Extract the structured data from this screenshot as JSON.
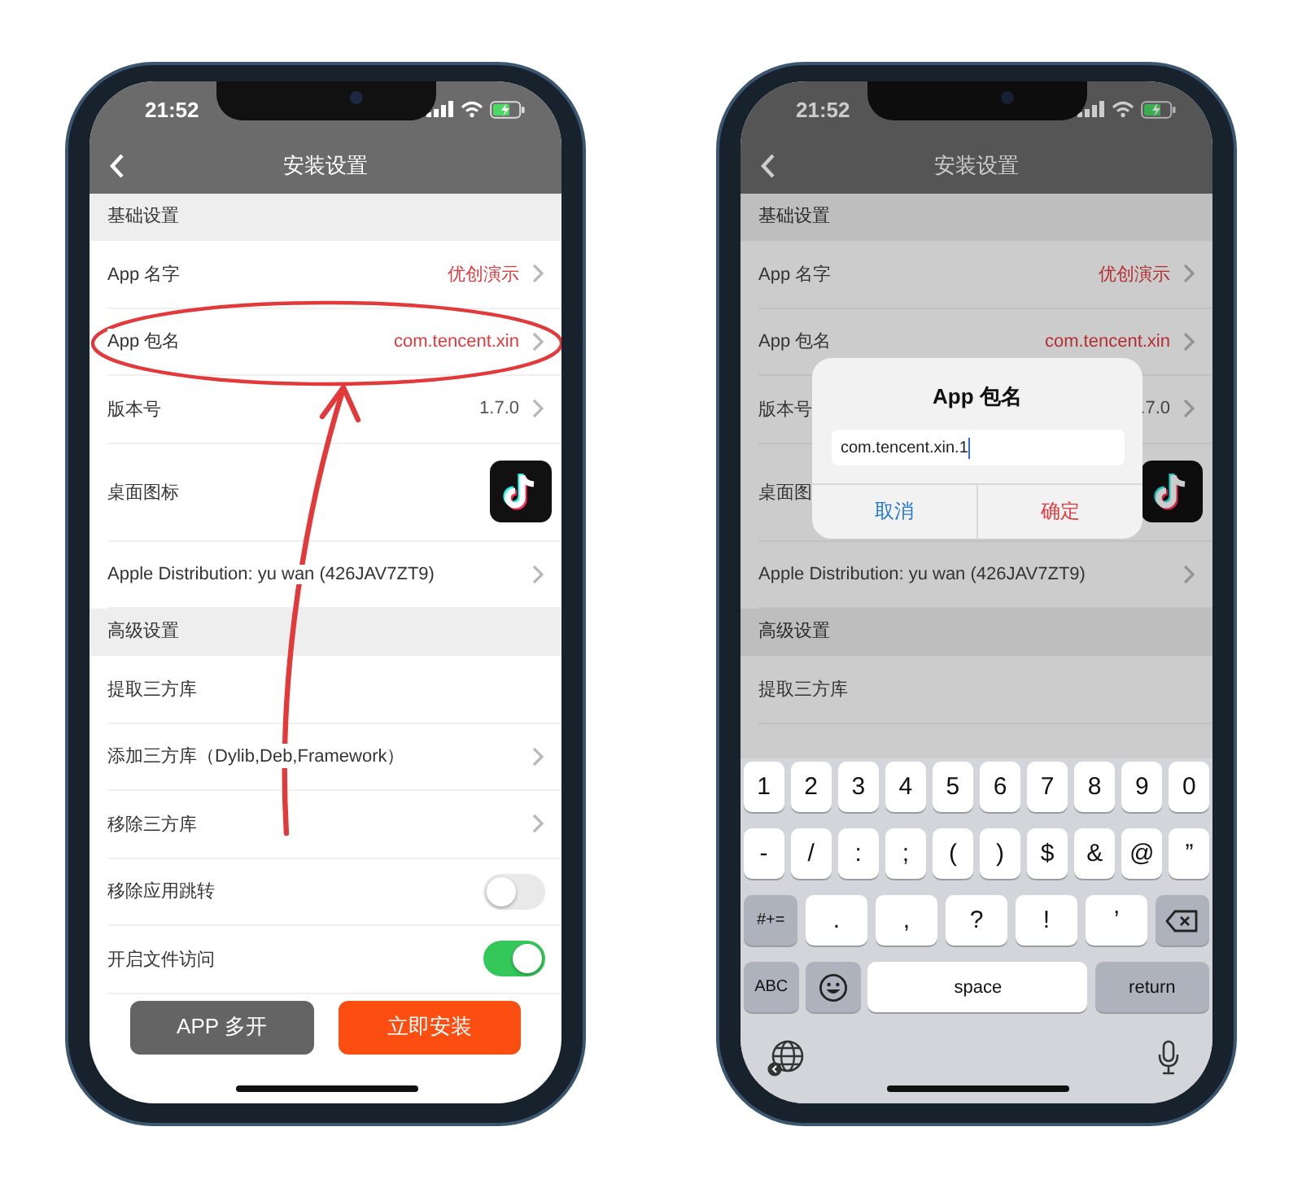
{
  "phones": [
    {
      "status_bar": {
        "time": "21:52"
      },
      "nav": {
        "title": "安装设置"
      },
      "annotated": true,
      "sections": [
        {
          "header": "基础设置",
          "rows": [
            {
              "kind": "value",
              "label": "App 名字",
              "value": "优创演示",
              "accent": true,
              "chevron": true
            },
            {
              "kind": "value",
              "label": "App 包名",
              "value": "com.tencent.xin",
              "accent": true,
              "chevron": true
            },
            {
              "kind": "value",
              "label": "版本号",
              "value": "1.7.0",
              "accent": false,
              "chevron": true
            },
            {
              "kind": "icon",
              "label": "桌面图标"
            },
            {
              "kind": "value",
              "label": "Apple Distribution: yu wan (426JAV7ZT9)",
              "chevron": true
            }
          ]
        },
        {
          "header": "高级设置",
          "rows": [
            {
              "kind": "value",
              "label": "提取三方库"
            },
            {
              "kind": "value",
              "label": "添加三方库（Dylib,Deb,Framework）",
              "chevron": true
            },
            {
              "kind": "value",
              "label": "移除三方库",
              "chevron": true
            },
            {
              "kind": "toggle",
              "label": "移除应用跳转",
              "on": false
            },
            {
              "kind": "toggle",
              "label": "开启文件访问",
              "on": true
            }
          ]
        }
      ],
      "buttons": [
        {
          "label": "APP 多开",
          "kind": "secondary"
        },
        {
          "label": "立即安装",
          "kind": "primary"
        }
      ]
    },
    {
      "status_bar": {
        "time": "21:52"
      },
      "nav": {
        "title": "安装设置"
      },
      "dimmed": true,
      "sections": [
        {
          "header": "基础设置",
          "rows": [
            {
              "kind": "value",
              "label": "App 名字",
              "value": "优创演示",
              "accent": true,
              "chevron": true
            },
            {
              "kind": "value",
              "label": "App 包名",
              "value": "com.tencent.xin",
              "accent": true,
              "chevron": true
            },
            {
              "kind": "value",
              "label": "版本号",
              "value": ".7.0",
              "accent": false,
              "chevron": true
            },
            {
              "kind": "icon",
              "label": "桌面图"
            },
            {
              "kind": "value",
              "label": "Apple Distribution: yu wan (426JAV7ZT9)",
              "chevron": true
            }
          ]
        },
        {
          "header": "高级设置",
          "rows": [
            {
              "kind": "value",
              "label": "提取三方库"
            }
          ]
        }
      ],
      "dialog": {
        "title": "App 包名",
        "value": "com.tencent.xin.1",
        "buttons": [
          {
            "label": "取消",
            "kind": "cancel"
          },
          {
            "label": "确定",
            "kind": "confirm"
          }
        ]
      },
      "keyboard": {
        "rows": [
          {
            "keys": [
              {
                "kind": "char",
                "label": "1"
              },
              {
                "kind": "char",
                "label": "2"
              },
              {
                "kind": "char",
                "label": "3"
              },
              {
                "kind": "char",
                "label": "4"
              },
              {
                "kind": "char",
                "label": "5"
              },
              {
                "kind": "char",
                "label": "6"
              },
              {
                "kind": "char",
                "label": "7"
              },
              {
                "kind": "char",
                "label": "8"
              },
              {
                "kind": "char",
                "label": "9"
              },
              {
                "kind": "char",
                "label": "0"
              }
            ]
          },
          {
            "keys": [
              {
                "kind": "char",
                "label": "-"
              },
              {
                "kind": "char",
                "label": "/"
              },
              {
                "kind": "char",
                "label": ":"
              },
              {
                "kind": "char",
                "label": ";"
              },
              {
                "kind": "char",
                "label": "("
              },
              {
                "kind": "char",
                "label": ")"
              },
              {
                "kind": "char",
                "label": "$"
              },
              {
                "kind": "char",
                "label": "&"
              },
              {
                "kind": "char",
                "label": "@"
              },
              {
                "kind": "char",
                "label": "”"
              }
            ]
          },
          {
            "keys": [
              {
                "kind": "function",
                "label": "#+="
              },
              {
                "kind": "wide",
                "label": "."
              },
              {
                "kind": "wide",
                "label": ","
              },
              {
                "kind": "wide",
                "label": "?"
              },
              {
                "kind": "wide",
                "label": "!"
              },
              {
                "kind": "wide",
                "label": "’"
              },
              {
                "kind": "delete"
              }
            ]
          },
          {
            "keys": [
              {
                "kind": "function",
                "label": "ABC"
              },
              {
                "kind": "emoji"
              },
              {
                "kind": "space",
                "label": "space"
              },
              {
                "kind": "return",
                "label": "return"
              }
            ]
          }
        ]
      }
    }
  ]
}
